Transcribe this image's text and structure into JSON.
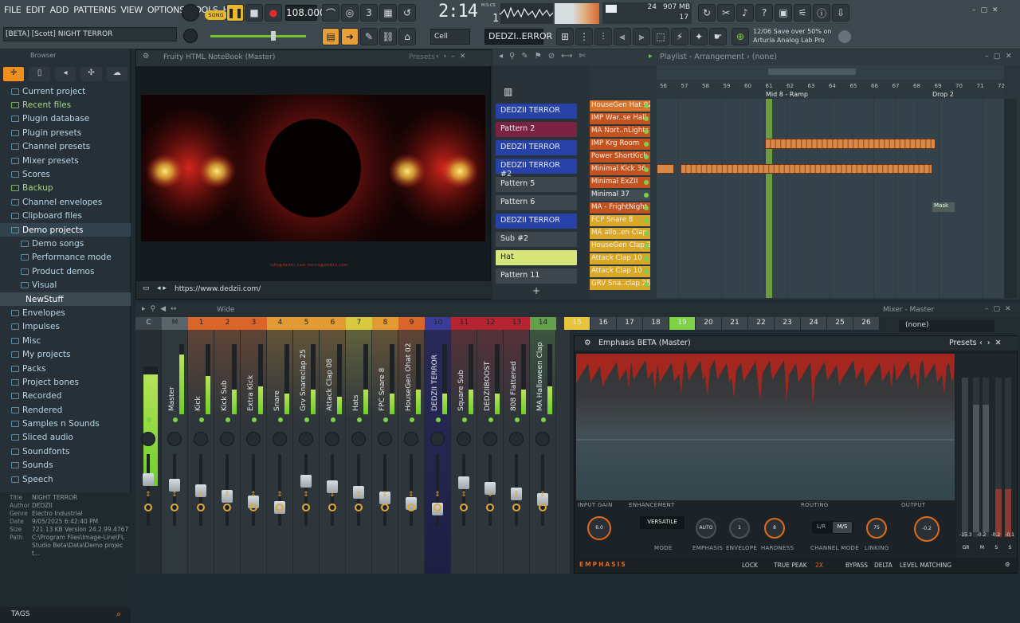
{
  "menu": [
    "FILE",
    "EDIT",
    "ADD",
    "PATTERNS",
    "VIEW",
    "OPTIONS",
    "TOOLS",
    "HELP"
  ],
  "transport": {
    "mode_label": "SONG",
    "bpm": "108.000",
    "time": "2:14",
    "time_sub": "17",
    "time_unit": "M:S:CS"
  },
  "cpu": {
    "voices": "24",
    "memory": "907 MB",
    "cpu": "17"
  },
  "song_title": "[BETA] [Scott] NIGHT TERROR",
  "snap": "Cell",
  "current_pattern": "DEDZI..ERROR",
  "news": {
    "date": "12/06",
    "line1": "Save over 50% on",
    "line2": "Arturia Analog Lab Pro"
  },
  "browser": {
    "title": "Browser",
    "items": [
      {
        "label": "Current project",
        "kind": "folder"
      },
      {
        "label": "Recent files",
        "kind": "green"
      },
      {
        "label": "Plugin database",
        "kind": "folder"
      },
      {
        "label": "Plugin presets",
        "kind": "folder"
      },
      {
        "label": "Channel presets",
        "kind": "folder"
      },
      {
        "label": "Mixer presets",
        "kind": "folder"
      },
      {
        "label": "Scores",
        "kind": "folder"
      },
      {
        "label": "Backup",
        "kind": "green"
      },
      {
        "label": "Channel envelopes",
        "kind": "folder"
      },
      {
        "label": "Clipboard files",
        "kind": "folder"
      },
      {
        "label": "Demo projects",
        "kind": "open"
      },
      {
        "label": "Demo songs",
        "kind": "sub"
      },
      {
        "label": "Performance mode",
        "kind": "sub"
      },
      {
        "label": "Product demos",
        "kind": "sub"
      },
      {
        "label": "Visual",
        "kind": "sub"
      },
      {
        "label": "NewStuff",
        "kind": "hl"
      },
      {
        "label": "Envelopes",
        "kind": "folder"
      },
      {
        "label": "Impulses",
        "kind": "folder"
      },
      {
        "label": "Misc",
        "kind": "folder"
      },
      {
        "label": "My projects",
        "kind": "folder"
      },
      {
        "label": "Packs",
        "kind": "folder"
      },
      {
        "label": "Project bones",
        "kind": "folder"
      },
      {
        "label": "Recorded",
        "kind": "folder"
      },
      {
        "label": "Rendered",
        "kind": "folder"
      },
      {
        "label": "Samples n Sounds",
        "kind": "folder"
      },
      {
        "label": "Sliced audio",
        "kind": "folder"
      },
      {
        "label": "Soundfonts",
        "kind": "folder"
      },
      {
        "label": "Sounds",
        "kind": "folder"
      },
      {
        "label": "Speech",
        "kind": "folder"
      }
    ],
    "info": {
      "title_k": "Title",
      "title": "NIGHT TERROR",
      "author_k": "Author",
      "author": "DEDZII",
      "genre_k": "Genre",
      "genre": "Electro Industrial",
      "date_k": "Date",
      "date": "9/05/2025 6:42:40 PM",
      "size_k": "Size",
      "size": "721.13 KB",
      "version_k": "Version",
      "version": "24.2.99.4767",
      "path_k": "Path",
      "path": "C:\\Program Files\\Image-Line\\FL Studio Beta\\Data\\Demo project..."
    },
    "tags_label": "TAGS"
  },
  "notebook": {
    "title": "Fruity HTML NoteBook",
    "target": "(Master)",
    "presets": "Presets",
    "url": "https://www.dedzii.com/",
    "video_text": "info@dedzii.com     rehire@dedzii.com"
  },
  "patterns": [
    {
      "label": "DEDZII TERROR",
      "color": "#2741a6"
    },
    {
      "label": "Pattern 2",
      "color": "#7a2242"
    },
    {
      "label": "DEDZII TERROR",
      "color": "#2741a6"
    },
    {
      "label": "DEDZII TERROR #2",
      "color": "#2741a6"
    },
    {
      "label": "Pattern 5",
      "color": "#3d464c"
    },
    {
      "label": "Pattern 6",
      "color": "#3d464c"
    },
    {
      "label": "DEDZII TERROR",
      "color": "#2741a6"
    },
    {
      "label": "Sub #2",
      "color": "#3d464c"
    },
    {
      "label": "Hat",
      "color": "#d7e67a"
    },
    {
      "label": "Pattern 11",
      "color": "#3d464c"
    }
  ],
  "channels": [
    {
      "label": "HouseGen Hat 02",
      "color": "#d6742b"
    },
    {
      "label": "IMP War..se Hall",
      "color": "#c2521f"
    },
    {
      "label": "MA Nort..nLights",
      "color": "#c2521f"
    },
    {
      "label": "IMP Krg Room",
      "color": "#c2521f"
    },
    {
      "label": "Power ShortKick",
      "color": "#c2521f"
    },
    {
      "label": "Minimal Kick 36",
      "color": "#c2521f"
    },
    {
      "label": "Minimal ExZII",
      "color": "#c2521f"
    },
    {
      "label": "Minimal 37",
      "color": "#3f4c54"
    },
    {
      "label": "MA - FrightNight",
      "color": "#c2521f"
    },
    {
      "label": "FCP Snare 8",
      "color": "#d9a72a"
    },
    {
      "label": "MA allo..en Clap",
      "color": "#d9a72a"
    },
    {
      "label": "HouseGen Clap 2",
      "color": "#d9a72a"
    },
    {
      "label": "Attack Clap 10",
      "color": "#d9a72a"
    },
    {
      "label": "Attack Clap 10",
      "color": "#d9a72a"
    },
    {
      "label": "GRV Sna..clap 25",
      "color": "#d9a72a"
    }
  ],
  "playlist": {
    "title": "Playlist - Arrangement",
    "sel": "(none)",
    "bars": [
      "56",
      "57",
      "58",
      "59",
      "60",
      "61",
      "62",
      "63",
      "64",
      "65",
      "66",
      "67",
      "68",
      "69",
      "70",
      "71",
      "72"
    ],
    "markers": [
      {
        "label": "Mid 8 - Ramp"
      },
      {
        "label": "Drop 2"
      }
    ],
    "clip_label": "Mask"
  },
  "mixer": {
    "title": "Mixer - Master",
    "view": "Wide",
    "route": "(none)",
    "tracks": [
      {
        "num": "C",
        "name": "",
        "color": "#3b454b"
      },
      {
        "num": "M",
        "name": "Master",
        "color": "#59646b"
      },
      {
        "num": "1",
        "name": "Kick",
        "color": "#d9652a"
      },
      {
        "num": "2",
        "name": "Kick Sub",
        "color": "#d9652a"
      },
      {
        "num": "3",
        "name": "Extra Kick",
        "color": "#d9652a"
      },
      {
        "num": "4",
        "name": "Snare",
        "color": "#e29b32"
      },
      {
        "num": "5",
        "name": "Grv Snareclap 25",
        "color": "#e29b32"
      },
      {
        "num": "6",
        "name": "Attack Clap 08",
        "color": "#e29b32"
      },
      {
        "num": "7",
        "name": "Hats",
        "color": "#d8c940"
      },
      {
        "num": "8",
        "name": "FPC Snare 8",
        "color": "#e29b32"
      },
      {
        "num": "9",
        "name": "HouseGen Ohat 02",
        "color": "#d9652a"
      },
      {
        "num": "10",
        "name": "DEDZII TERROR",
        "color": "#3b3b9a"
      },
      {
        "num": "11",
        "name": "Square Sub",
        "color": "#b52431"
      },
      {
        "num": "12",
        "name": "DEDZIIBOOST",
        "color": "#b52431"
      },
      {
        "num": "13",
        "name": "808 Flattened",
        "color": "#b52431"
      },
      {
        "num": "14",
        "name": "MA Halloween Clap",
        "color": "#62a04c"
      }
    ],
    "more_tracks": [
      "15",
      "16",
      "17",
      "18",
      "19",
      "20",
      "21",
      "22",
      "23",
      "24",
      "25",
      "26"
    ]
  },
  "emphasis": {
    "title": "Emphasis BETA (Master)",
    "presets": "Presets",
    "sections": {
      "input": "INPUT GAIN",
      "enh": "ENHANCEMENT",
      "routing": "ROUTING",
      "output": "OUTPUT"
    },
    "input_gain": "6.0",
    "mode": "VERSATILE",
    "emphasis": "AUTO",
    "envelope": "1",
    "hardness": "8",
    "link": "75",
    "output": "-0.2",
    "ch_a": "L/R",
    "ch_b": "M/S",
    "labels": {
      "mode": "MODE",
      "emphasis": "EMPHASIS",
      "envelope": "ENVELOPE",
      "hardness": "HARDNESS",
      "chmode": "CHANNEL MODE",
      "linking": "LINKING"
    },
    "footer": {
      "brand": "EMPHASIS",
      "lock": "LOCK",
      "tp": "TRUE PEAK",
      "os": "2X",
      "bypass": "BYPASS",
      "delta": "DELTA",
      "lm": "LEVEL MATCHING"
    },
    "meter_vals": [
      "-15.3",
      "-0.2",
      "-0.2",
      "-0.1"
    ],
    "meter_lbl": [
      "GR",
      "M",
      "S",
      "S"
    ]
  }
}
